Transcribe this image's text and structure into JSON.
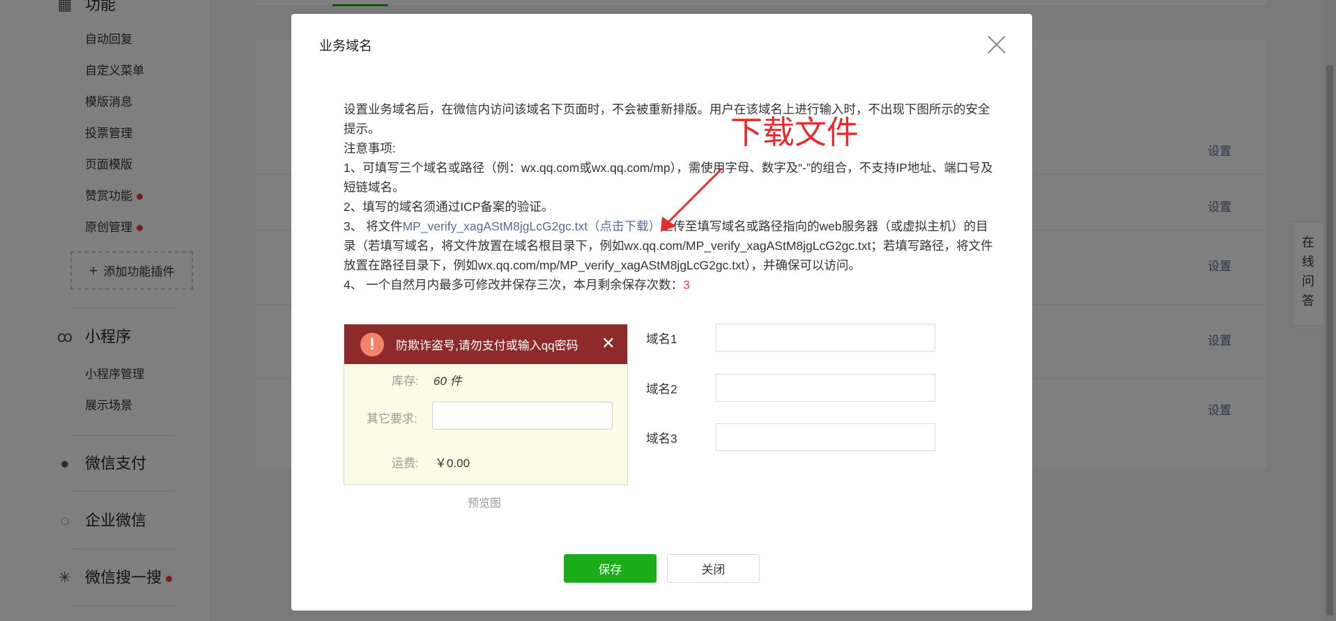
{
  "sidebar": {
    "func_section_label": "功能",
    "func_items": [
      {
        "label": "自动回复",
        "dot": false
      },
      {
        "label": "自定义菜单",
        "dot": false
      },
      {
        "label": "模版消息",
        "dot": false
      },
      {
        "label": "投票管理",
        "dot": false
      },
      {
        "label": "页面模版",
        "dot": false
      },
      {
        "label": "赞赏功能",
        "dot": true
      },
      {
        "label": "原创管理",
        "dot": true
      }
    ],
    "add_plugin_label": "添加功能插件",
    "miniprogram": {
      "label": "小程序",
      "items": [
        "小程序管理",
        "展示场景"
      ]
    },
    "wechat_pay": "微信支付",
    "wecom": "企业微信",
    "wechat_search": "微信搜一搜"
  },
  "content": {
    "settings_label": "设置"
  },
  "online_qa": [
    "在",
    "线",
    "问",
    "答"
  ],
  "dialog": {
    "title": "业务域名",
    "desc_intro": "设置业务域名后，在微信内访问该域名下页面时，不会被重新排版。用户在该域名上进行输入时，不出现下图所示的安全提示。",
    "notes_title": "注意事项:",
    "note1": "1、可填写三个域名或路径（例：wx.qq.com或wx.qq.com/mp），需使用字母、数字及“-”的组合，不支持IP地址、端口号及短链域名。",
    "note2": "2、填写的域名须通过ICP备案的验证。",
    "note3_prefix": "3、 将文件",
    "note3_link": "MP_verify_xagAStM8jgLcG2gc.txt（点击下载）",
    "note3_suffix": "上传至填写域名或路径指向的web服务器（或虚拟主机）的目录（若填写域名，将文件放置在域名根目录下，例如wx.qq.com/MP_verify_xagAStM8jgLcG2gc.txt；若填写路径，将文件放置在路径目录下，例如wx.qq.com/mp/MP_verify_xagAStM8jgLcG2gc.txt），并确保可以访问。",
    "note4_prefix": "4、 一个自然月内最多可修改并保存三次，本月剩余保存次数：",
    "note4_remaining": "3",
    "annotation": "下载文件",
    "preview": {
      "banner_text": "防欺诈盗号,请勿支付或输入qq密码",
      "stock_label": "库存:",
      "stock_value": "60 件",
      "other_label": "其它要求:",
      "shipping_label": "运费:",
      "shipping_value": "￥0.00",
      "caption": "预览图"
    },
    "domains": [
      {
        "label": "域名1",
        "value": ""
      },
      {
        "label": "域名2",
        "value": ""
      },
      {
        "label": "域名3",
        "value": ""
      }
    ],
    "save_label": "保存",
    "close_label": "关闭"
  },
  "colors": {
    "primary_green": "#1aad19",
    "link_blue": "#576b95",
    "danger_red": "#e64340",
    "annotation_red": "#e52e2e"
  }
}
